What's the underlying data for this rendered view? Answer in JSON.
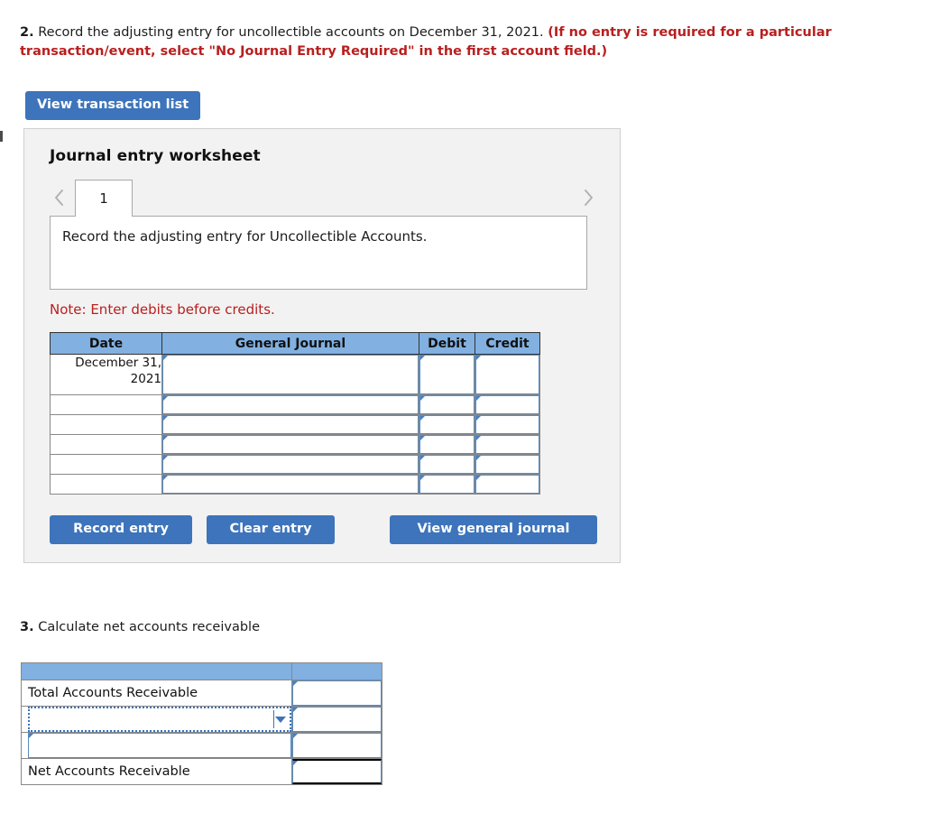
{
  "q2": {
    "number": "2.",
    "text": " Record the adjusting entry for uncollectible accounts on December 31, 2021. ",
    "warning": "(If no entry is required for a particular transaction/event, select \"No Journal Entry Required\" in the first account field.)"
  },
  "view_transaction_list_label": "View transaction list",
  "worksheet": {
    "title": "Journal entry worksheet",
    "tabs": [
      {
        "label": "1"
      }
    ],
    "prev_icon": "chevron-left-icon",
    "next_icon": "chevron-right-icon",
    "panel_text": "Record the adjusting entry for Uncollectible Accounts.",
    "note": "Note: Enter debits before credits.",
    "table": {
      "headers": [
        "Date",
        "General Journal",
        "Debit",
        "Credit"
      ],
      "rows": [
        {
          "date": "December 31, 2021",
          "general_journal": "",
          "debit": "",
          "credit": ""
        },
        {
          "date": "",
          "general_journal": "",
          "debit": "",
          "credit": ""
        },
        {
          "date": "",
          "general_journal": "",
          "debit": "",
          "credit": ""
        },
        {
          "date": "",
          "general_journal": "",
          "debit": "",
          "credit": ""
        },
        {
          "date": "",
          "general_journal": "",
          "debit": "",
          "credit": ""
        },
        {
          "date": "",
          "general_journal": "",
          "debit": "",
          "credit": ""
        }
      ]
    },
    "buttons": {
      "record_entry": "Record entry",
      "clear_entry": "Clear entry",
      "view_general_journal": "View general journal"
    }
  },
  "q3": {
    "number": "3.",
    "text": " Calculate net accounts receivable",
    "table": {
      "headers": [
        "",
        ""
      ],
      "rows": [
        {
          "label": "Total Accounts Receivable",
          "value": "",
          "type": "label-value"
        },
        {
          "label": "",
          "value": "",
          "type": "dropdown-value"
        },
        {
          "label": "",
          "value": "",
          "type": "input-value"
        },
        {
          "label": "Net Accounts Receivable",
          "value": "",
          "type": "total"
        }
      ]
    }
  },
  "colors": {
    "button_blue": "#3d74bb",
    "header_blue": "#82b0e0",
    "warning_red": "#b91f1f",
    "panel_gray": "#f2f2f2",
    "cell_border_blue": "#5a8bbd"
  }
}
